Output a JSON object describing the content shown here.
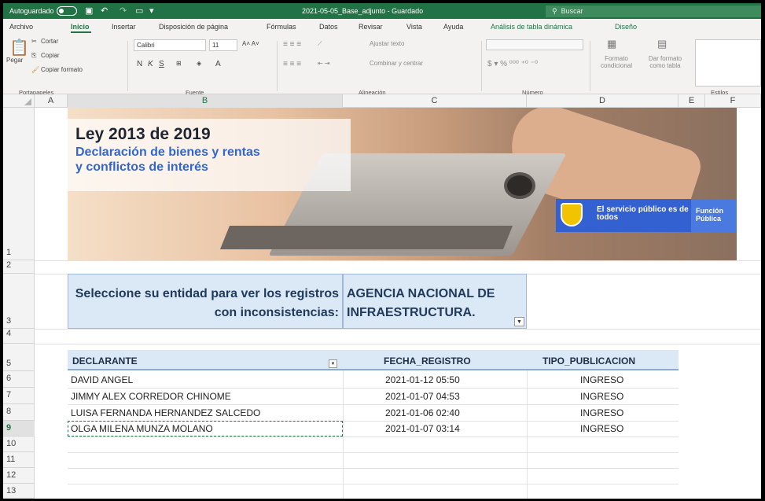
{
  "title_bar": {
    "autosave_label": "Autoguardado",
    "document_title": "2021-05-05_Base_adjunto - Guardado",
    "search_label": "Buscar"
  },
  "menu": {
    "tabs": [
      "Archivo",
      "Inicio",
      "Insertar",
      "Disposición de página",
      "Fórmulas",
      "Datos",
      "Revisar",
      "Vista",
      "Ayuda"
    ],
    "context_tabs": [
      "Análisis de tabla dinámica",
      "Diseño"
    ],
    "active_tab": "Inicio"
  },
  "ribbon": {
    "clipboard": {
      "paste": "Pegar",
      "cut": "Cortar",
      "copy": "Copiar",
      "format_painter": "Copiar formato",
      "group": "Portapapeles"
    },
    "font": {
      "name": "Calibri",
      "size": "11",
      "group": "Fuente"
    },
    "alignment": {
      "wrap": "Ajustar texto",
      "merge": "Combinar y centrar",
      "group": "Alineación"
    },
    "number": {
      "group": "Número"
    },
    "styles": {
      "conditional": "Formato condicional",
      "table": "Dar formato como tabla",
      "group": "Estilos"
    }
  },
  "columns": [
    "A",
    "B",
    "C",
    "D",
    "E",
    "F"
  ],
  "rows": [
    "1",
    "2",
    "3",
    "4",
    "5",
    "6",
    "7",
    "8",
    "9",
    "10",
    "11",
    "12",
    "13"
  ],
  "banner": {
    "title": "Ley 2013 de 2019",
    "subtitle_line1": "Declaración de bienes y rentas",
    "subtitle_line2": "y conflictos de interés",
    "slogan": "El servicio público es de todos",
    "brand": "Función Pública"
  },
  "selector": {
    "label": "Seleccione su entidad para ver los registros con inconsistencias:",
    "entity": "AGENCIA NACIONAL DE INFRAESTRUCTURA."
  },
  "table": {
    "headers": [
      "DECLARANTE",
      "FECHA_REGISTRO",
      "TIPO_PUBLICACION"
    ],
    "rows": [
      [
        "DAVID ANGEL",
        "2021-01-12 05:50",
        "INGRESO"
      ],
      [
        "JIMMY ALEX CORREDOR CHINOME",
        "2021-01-07 04:53",
        "INGRESO"
      ],
      [
        "LUISA FERNANDA HERNANDEZ SALCEDO",
        "2021-01-06 02:40",
        "INGRESO"
      ],
      [
        "OLGA MILENA MUNZA MOLANO",
        "2021-01-07 03:14",
        "INGRESO"
      ]
    ]
  },
  "colors": {
    "excel_green": "#217346",
    "table_header": "#dbe8f6",
    "brand_blue": "#3461d1"
  }
}
